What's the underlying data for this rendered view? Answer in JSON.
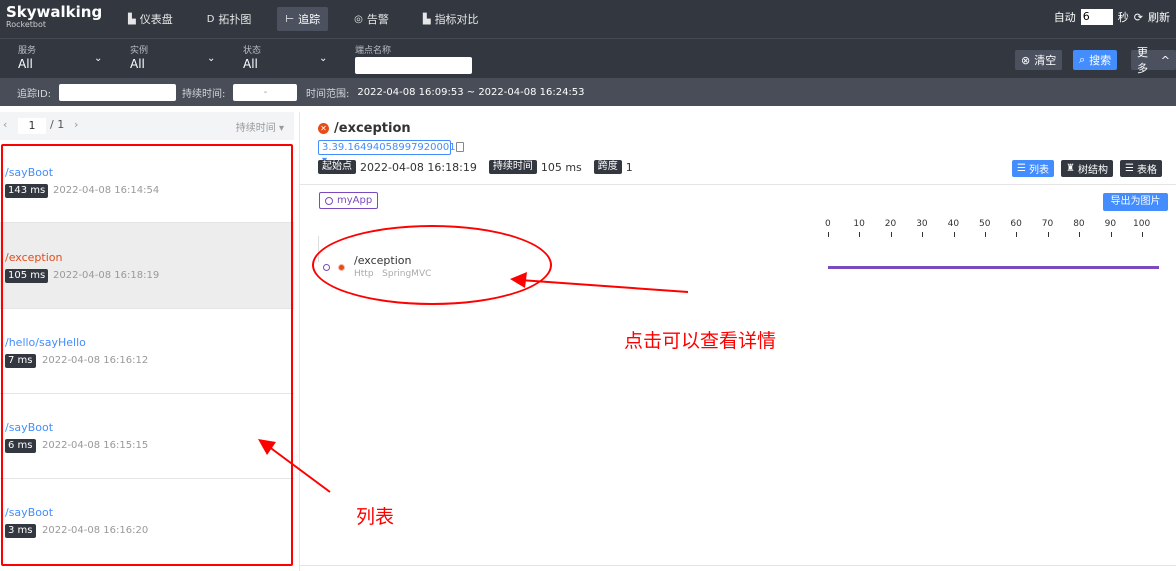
{
  "app": {
    "logo": "Skywalking",
    "sub": "Rocketbot"
  },
  "nav": [
    {
      "icon": "dashboard-icon",
      "glyph": "▙",
      "label": "仪表盘",
      "active": false
    },
    {
      "icon": "topology-icon",
      "glyph": "⟳",
      "label": "拓扑图",
      "active": false
    },
    {
      "icon": "trace-icon",
      "glyph": "⊢",
      "label": "追踪",
      "active": true
    },
    {
      "icon": "alarm-icon",
      "glyph": "◎",
      "label": "告警",
      "active": false
    },
    {
      "icon": "compare-icon",
      "glyph": "▙",
      "label": "指标对比",
      "active": false
    }
  ],
  "auto": {
    "label": "自动",
    "seconds": "6",
    "unit": "秒",
    "refresh": "刷新"
  },
  "filters": {
    "service": {
      "label": "服务",
      "value": "All"
    },
    "instance": {
      "label": "实例",
      "value": "All"
    },
    "status": {
      "label": "状态",
      "value": "All"
    },
    "endpoint": {
      "label": "端点名称",
      "value": ""
    }
  },
  "buttons": {
    "clear": "清空",
    "search": "搜索",
    "more": "更多"
  },
  "conditions": {
    "trace_id_label": "追踪ID:",
    "trace_id_value": "",
    "duration_label": "持续时间:",
    "duration_value": "-",
    "time_range_label": "时间范围:",
    "time_range_value": "2022-04-08 16:09:53 ~ 2022-04-08 16:24:53"
  },
  "pager": {
    "page": "1",
    "total": "/ 1",
    "prev": "‹",
    "next": "›",
    "sort": "持续时间 ▾"
  },
  "traces": [
    {
      "endpoint": "/sayBoot",
      "duration": "143 ms",
      "time": "2022-04-08 16:14:54",
      "error": false,
      "active": false
    },
    {
      "endpoint": "/exception",
      "duration": "105 ms",
      "time": "2022-04-08 16:18:19",
      "error": true,
      "active": true
    },
    {
      "endpoint": "/hello/sayHello",
      "duration": "7 ms",
      "time": "2022-04-08 16:16:12",
      "error": false,
      "active": false
    },
    {
      "endpoint": "/sayBoot",
      "duration": "6 ms",
      "time": "2022-04-08 16:15:15",
      "error": false,
      "active": false
    },
    {
      "endpoint": "/sayBoot",
      "duration": "3 ms",
      "time": "2022-04-08 16:16:20",
      "error": false,
      "active": false
    }
  ],
  "detail": {
    "title": "/exception",
    "trace_id": "3.39.16494058997920001",
    "start_label": "起始点",
    "start_value": "2022-04-08 16:18:19",
    "duration_label": "持续时间",
    "duration_value": "105 ms",
    "span_label": "跨度",
    "span_value": "1",
    "views": {
      "list": "列表",
      "tree": "树结构",
      "table": "表格"
    },
    "app": "myApp",
    "export": "导出为图片",
    "scale": [
      "0",
      "10",
      "20",
      "30",
      "40",
      "50",
      "60",
      "70",
      "80",
      "90",
      "100"
    ],
    "span": {
      "name": "/exception",
      "layer": "Http",
      "component": "SpringMVC"
    }
  },
  "annotations": {
    "detail": "点击可以查看详情",
    "list": "列表"
  },
  "colors": {
    "accent": "#448dfe",
    "error": "#e54c17",
    "app": "#7b4bbd",
    "annotation": "#ff0000",
    "dark": "#333840"
  }
}
